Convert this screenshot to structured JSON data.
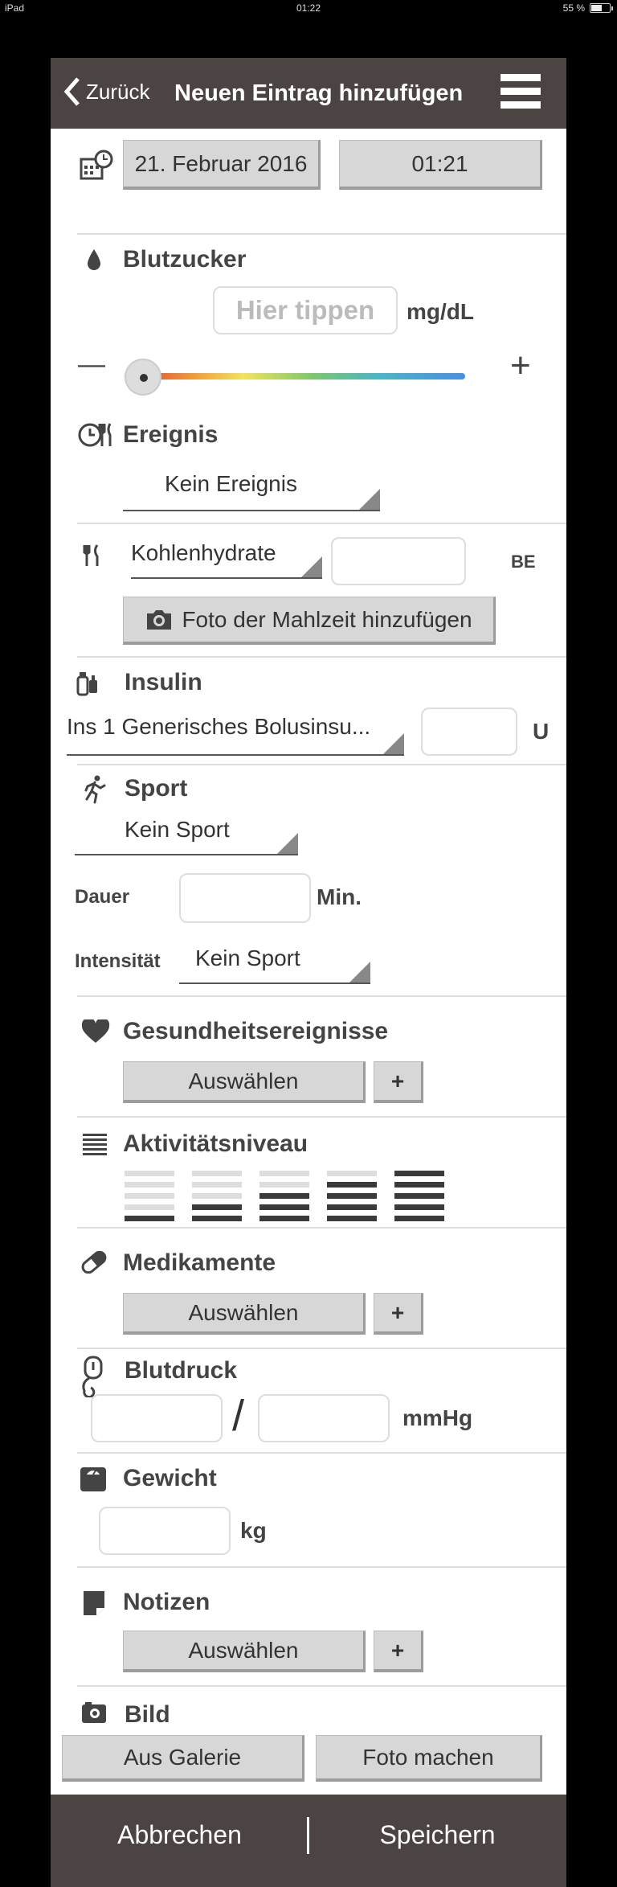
{
  "status_bar": {
    "device": "iPad",
    "time": "01:22",
    "battery": "55 %"
  },
  "nav": {
    "back_label": "Zurück",
    "title": "Neuen Eintrag hinzufügen"
  },
  "date": {
    "date_value": "21. Februar 2016",
    "time_value": "01:21"
  },
  "blood_sugar": {
    "heading": "Blutzucker",
    "placeholder": "Hier tippen",
    "unit": "mg/dL",
    "minus": "—",
    "plus": "+"
  },
  "event": {
    "heading": "Ereignis",
    "selected": "Kein Ereignis"
  },
  "carbs": {
    "selected": "Kohlenhydrate",
    "unit": "BE",
    "photo_button": "Foto der Mahlzeit hinzufügen"
  },
  "insulin": {
    "heading": "Insulin",
    "selected": "Ins 1 Generisches Bolusinsu...",
    "unit": "U"
  },
  "sport": {
    "heading": "Sport",
    "selected": "Kein Sport",
    "duration_label": "Dauer",
    "duration_unit": "Min.",
    "intensity_label": "Intensität",
    "intensity_selected": "Kein Sport"
  },
  "health": {
    "heading": "Gesundheitsereignisse",
    "select_label": "Auswählen",
    "add_label": "+"
  },
  "activity": {
    "heading": "Aktivitätsniveau",
    "levels": [
      1,
      2,
      3,
      4,
      5
    ]
  },
  "medication": {
    "heading": "Medikamente",
    "select_label": "Auswählen",
    "add_label": "+"
  },
  "blood_pressure": {
    "heading": "Blutdruck",
    "separator": "/",
    "unit": "mmHg"
  },
  "weight": {
    "heading": "Gewicht",
    "unit": "kg"
  },
  "notes": {
    "heading": "Notizen",
    "select_label": "Auswählen",
    "add_label": "+"
  },
  "image": {
    "heading": "Bild",
    "gallery_label": "Aus Galerie",
    "camera_label": "Foto machen"
  },
  "footer": {
    "cancel_label": "Abbrechen",
    "save_label": "Speichern"
  },
  "colors": {
    "nav_bg": "#4b4443",
    "button_bg": "#d7d7d7"
  }
}
